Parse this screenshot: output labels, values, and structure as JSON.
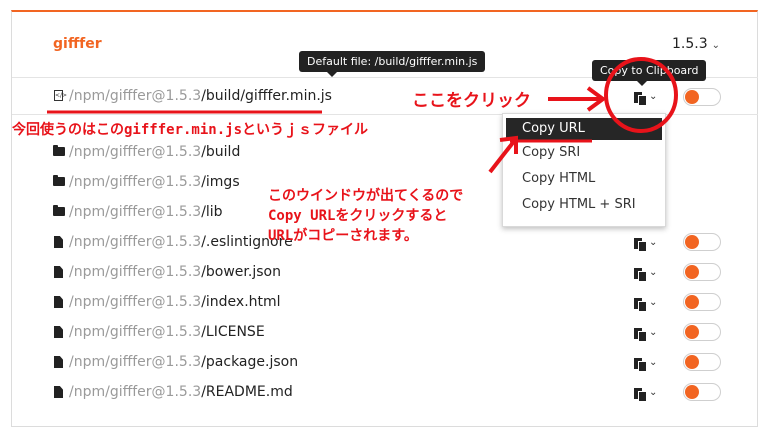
{
  "package": {
    "name": "gifffer",
    "version": "1.5.3"
  },
  "tooltips": {
    "default_file": "Default file: /build/gifffer.min.js",
    "copy_to_clipboard": "Copy to Clipboard"
  },
  "files": [
    {
      "prefix": "/npm/gifffer@1.5.3",
      "name": "/build/gifffer.min.js",
      "icon": "file-code-icon"
    },
    {
      "prefix": "/npm/gifffer@1.5.3",
      "name": "/build",
      "icon": "folder-icon"
    },
    {
      "prefix": "/npm/gifffer@1.5.3",
      "name": "/imgs",
      "icon": "folder-icon"
    },
    {
      "prefix": "/npm/gifffer@1.5.3",
      "name": "/lib",
      "icon": "folder-icon"
    },
    {
      "prefix": "/npm/gifffer@1.5.3",
      "name": "/.eslintignore",
      "icon": "file-icon"
    },
    {
      "prefix": "/npm/gifffer@1.5.3",
      "name": "/bower.json",
      "icon": "file-icon"
    },
    {
      "prefix": "/npm/gifffer@1.5.3",
      "name": "/index.html",
      "icon": "file-icon"
    },
    {
      "prefix": "/npm/gifffer@1.5.3",
      "name": "/LICENSE",
      "icon": "file-icon"
    },
    {
      "prefix": "/npm/gifffer@1.5.3",
      "name": "/package.json",
      "icon": "file-icon"
    },
    {
      "prefix": "/npm/gifffer@1.5.3",
      "name": "/README.md",
      "icon": "file-icon"
    }
  ],
  "copy_menu": {
    "items": [
      "Copy URL",
      "Copy SRI",
      "Copy HTML",
      "Copy HTML + SRI"
    ]
  },
  "annotations": {
    "click_here": "ここをクリック",
    "file_note": "今回使うのはこのgifffer.min.jsというｊｓファイル",
    "menu_note_1": "このウインドウが出てくるので",
    "menu_note_2": "Copy URLをクリックすると",
    "menu_note_3": "URLがコピーされます。"
  },
  "colors": {
    "accent": "#f26522",
    "annotation": "#e8131a",
    "tooltip_bg": "#222222"
  }
}
